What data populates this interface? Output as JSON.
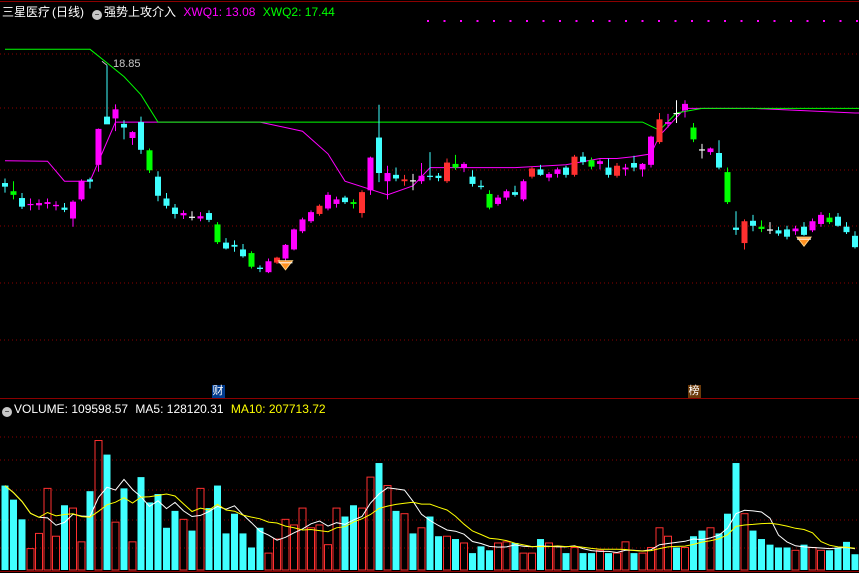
{
  "main_header": {
    "stock_title": "三星医疗",
    "period": "(日线)",
    "indicator_name": "强势上攻介入",
    "items": [
      {
        "label": "XWQ1: 13.08",
        "color": "#ff00ff"
      },
      {
        "label": "XWQ2: 17.44",
        "color": "#00ff00"
      }
    ]
  },
  "volume_header": {
    "volume_label": "VOLUME: 109598.57",
    "ma5_label": "MA5: 128120.31",
    "ma10_label": "MA10: 207713.72",
    "volume_color": "#ffffff",
    "ma5_color": "#ffffff",
    "ma10_color": "#ffff00"
  },
  "peak_label": "18.85",
  "event_marks": [
    {
      "text": "财",
      "day": 25,
      "bg": "#003a8c",
      "color": "#ffffff"
    },
    {
      "text": "榜",
      "day": 81,
      "bg": "#6b3a0a",
      "color": "#ffffff"
    }
  ],
  "colors": {
    "up": "#ff3030",
    "down": "#40ffff",
    "magenta": "#ff00ff",
    "green": "#00ff00",
    "yellow": "#ffff00",
    "white": "#ffffff",
    "grid": "#8b0000",
    "diamond": "#ff9020"
  },
  "chart_data": [
    {
      "type": "candlestick",
      "title": "强势上攻介入",
      "period": "daily",
      "y_range": [
        11.6,
        19.8
      ],
      "days": 101,
      "ohlc": [
        [
          16.26,
          16.36,
          16.05,
          16.18
        ],
        [
          16.08,
          16.3,
          15.9,
          16.0
        ],
        [
          15.93,
          16.04,
          15.69,
          15.74
        ],
        [
          15.78,
          15.92,
          15.66,
          15.8
        ],
        [
          15.77,
          15.9,
          15.67,
          15.82
        ],
        [
          15.8,
          15.92,
          15.7,
          15.84
        ],
        [
          15.75,
          15.86,
          15.66,
          15.78
        ],
        [
          15.72,
          15.82,
          15.62,
          15.67
        ],
        [
          15.48,
          15.88,
          15.3,
          15.85
        ],
        [
          15.9,
          16.34,
          15.86,
          16.31
        ],
        [
          16.34,
          16.38,
          16.14,
          16.29
        ],
        [
          16.66,
          17.46,
          16.51,
          17.45
        ],
        [
          17.72,
          18.85,
          17.64,
          17.55
        ],
        [
          17.68,
          17.99,
          17.4,
          17.88
        ],
        [
          17.56,
          17.64,
          17.22,
          17.48
        ],
        [
          17.25,
          17.4,
          17.1,
          17.38
        ],
        [
          17.6,
          17.72,
          16.9,
          16.99
        ],
        [
          16.98,
          17.02,
          16.48,
          16.54
        ],
        [
          16.4,
          16.52,
          15.86,
          15.98
        ],
        [
          15.92,
          16.04,
          15.7,
          15.76
        ],
        [
          15.72,
          15.8,
          15.48,
          15.58
        ],
        [
          15.55,
          15.66,
          15.47,
          15.6
        ],
        [
          15.52,
          15.64,
          15.44,
          15.5
        ],
        [
          15.48,
          15.62,
          15.42,
          15.53
        ],
        [
          15.6,
          15.66,
          15.4,
          15.45
        ],
        [
          15.35,
          15.4,
          14.92,
          14.96
        ],
        [
          14.95,
          15.05,
          14.8,
          14.82
        ],
        [
          14.9,
          15.0,
          14.75,
          14.86
        ],
        [
          14.8,
          14.92,
          14.62,
          14.65
        ],
        [
          14.72,
          14.76,
          14.38,
          14.42
        ],
        [
          14.4,
          14.45,
          14.3,
          14.37
        ],
        [
          14.3,
          14.6,
          14.28,
          14.54
        ],
        [
          14.51,
          14.64,
          14.48,
          14.62
        ],
        [
          14.6,
          14.92,
          14.55,
          14.9
        ],
        [
          14.8,
          15.26,
          14.78,
          15.24
        ],
        [
          15.2,
          15.5,
          15.16,
          15.46
        ],
        [
          15.42,
          15.66,
          15.38,
          15.62
        ],
        [
          15.58,
          15.79,
          15.54,
          15.76
        ],
        [
          15.7,
          16.06,
          15.66,
          16.0
        ],
        [
          15.8,
          15.96,
          15.72,
          15.9
        ],
        [
          15.94,
          15.98,
          15.8,
          15.84
        ],
        [
          15.84,
          15.9,
          15.7,
          15.8
        ],
        [
          15.6,
          16.1,
          15.5,
          16.06
        ],
        [
          16.1,
          16.84,
          16.0,
          16.82
        ],
        [
          17.26,
          17.98,
          16.28,
          16.48
        ],
        [
          16.3,
          16.64,
          15.9,
          16.48
        ],
        [
          16.44,
          16.6,
          16.3,
          16.36
        ],
        [
          16.3,
          16.44,
          16.2,
          16.34
        ],
        [
          16.32,
          16.46,
          16.1,
          16.3
        ],
        [
          16.3,
          16.7,
          16.24,
          16.42
        ],
        [
          16.42,
          16.94,
          16.32,
          16.4
        ],
        [
          16.42,
          16.48,
          16.3,
          16.37
        ],
        [
          16.3,
          16.8,
          16.26,
          16.71
        ],
        [
          16.68,
          16.88,
          16.55,
          16.6
        ],
        [
          16.6,
          16.72,
          16.5,
          16.68
        ],
        [
          16.4,
          16.54,
          16.18,
          16.24
        ],
        [
          16.2,
          16.32,
          16.12,
          16.17
        ],
        [
          16.02,
          16.1,
          15.68,
          15.72
        ],
        [
          15.8,
          16.0,
          15.76,
          15.94
        ],
        [
          15.94,
          16.12,
          15.88,
          16.08
        ],
        [
          16.06,
          16.2,
          15.96,
          16.0
        ],
        [
          15.9,
          16.34,
          15.86,
          16.3
        ],
        [
          16.4,
          16.62,
          16.36,
          16.58
        ],
        [
          16.56,
          16.66,
          16.42,
          16.44
        ],
        [
          16.38,
          16.5,
          16.3,
          16.46
        ],
        [
          16.46,
          16.6,
          16.38,
          16.56
        ],
        [
          16.6,
          16.64,
          16.38,
          16.44
        ],
        [
          16.44,
          16.88,
          16.4,
          16.84
        ],
        [
          16.84,
          16.94,
          16.66,
          16.72
        ],
        [
          16.76,
          16.82,
          16.56,
          16.62
        ],
        [
          16.68,
          16.78,
          16.56,
          16.74
        ],
        [
          16.6,
          16.8,
          16.38,
          16.44
        ],
        [
          16.42,
          16.7,
          16.38,
          16.64
        ],
        [
          16.56,
          16.68,
          16.42,
          16.6
        ],
        [
          16.7,
          16.86,
          16.52,
          16.6
        ],
        [
          16.56,
          16.7,
          16.4,
          16.68
        ],
        [
          16.66,
          17.3,
          16.6,
          17.28
        ],
        [
          17.16,
          17.8,
          17.12,
          17.66
        ],
        [
          17.56,
          17.78,
          17.48,
          17.6
        ],
        [
          17.8,
          18.08,
          17.58,
          17.78
        ],
        [
          17.86,
          18.08,
          17.7,
          18.0
        ],
        [
          17.48,
          17.58,
          17.16,
          17.22
        ],
        [
          17.0,
          17.12,
          16.8,
          16.98
        ],
        [
          16.94,
          17.04,
          16.88,
          17.02
        ],
        [
          16.92,
          17.2,
          16.56,
          16.6
        ],
        [
          16.5,
          16.6,
          15.8,
          15.84
        ],
        [
          15.28,
          15.64,
          15.12,
          15.23
        ],
        [
          14.94,
          15.46,
          14.8,
          15.42
        ],
        [
          15.43,
          15.56,
          15.2,
          15.32
        ],
        [
          15.3,
          15.44,
          15.18,
          15.25
        ],
        [
          15.24,
          15.4,
          15.14,
          15.22
        ],
        [
          15.22,
          15.3,
          15.1,
          15.15
        ],
        [
          15.24,
          15.32,
          15.02,
          15.08
        ],
        [
          15.2,
          15.32,
          15.12,
          15.26
        ],
        [
          15.3,
          15.4,
          15.1,
          15.12
        ],
        [
          15.22,
          15.48,
          15.18,
          15.42
        ],
        [
          15.36,
          15.62,
          15.3,
          15.56
        ],
        [
          15.5,
          15.6,
          15.36,
          15.4
        ],
        [
          15.52,
          15.6,
          15.3,
          15.32
        ],
        [
          15.3,
          15.4,
          15.14,
          15.18
        ],
        [
          15.1,
          15.2,
          14.82,
          14.85
        ]
      ],
      "lines": [
        {
          "name": "XWQ1",
          "color": "#ff00ff",
          "points": [
            [
              0,
              16.75
            ],
            [
              5,
              16.74
            ],
            [
              7,
              16.3
            ],
            [
              10,
              16.3
            ],
            [
              13,
              17.6
            ],
            [
              20,
              17.6
            ],
            [
              30,
              17.6
            ],
            [
              35,
              17.4
            ],
            [
              38,
              16.9
            ],
            [
              40,
              16.3
            ],
            [
              45,
              16.0
            ],
            [
              48,
              16.2
            ],
            [
              50,
              16.6
            ],
            [
              60,
              16.6
            ],
            [
              66,
              16.66
            ],
            [
              70,
              16.8
            ],
            [
              72,
              16.8
            ],
            [
              74,
              16.84
            ],
            [
              76,
              16.9
            ],
            [
              77,
              17.3
            ],
            [
              80,
              17.9
            ],
            [
              88,
              17.9
            ],
            [
              100,
              17.8
            ],
            [
              103,
              17.8
            ],
            [
              104,
              17.3
            ],
            [
              105,
              16.8
            ],
            [
              106,
              15.8
            ]
          ]
        },
        {
          "name": "XWQ2",
          "color": "#00ff00",
          "points": [
            [
              0,
              19.2
            ],
            [
              10,
              19.2
            ],
            [
              12,
              18.9
            ],
            [
              14,
              18.6
            ],
            [
              16,
              18.2
            ],
            [
              18,
              17.6
            ],
            [
              20,
              17.6
            ],
            [
              30,
              17.6
            ],
            [
              60,
              17.6
            ],
            [
              75,
              17.6
            ],
            [
              77,
              17.42
            ],
            [
              79,
              17.8
            ],
            [
              82,
              17.9
            ],
            [
              88,
              17.9
            ],
            [
              100,
              17.9
            ],
            [
              104,
              17.9
            ],
            [
              106,
              17.9
            ]
          ]
        }
      ],
      "signals": [
        {
          "type": "diamond",
          "day": 33,
          "price": 14.55
        },
        {
          "type": "diamond",
          "day": 94,
          "price": 15.07
        }
      ]
    },
    {
      "type": "bar",
      "title": "VOLUME",
      "unit": "hands",
      "y_range": [
        0,
        270000
      ],
      "values": [
        150000,
        125000,
        90000,
        38000,
        65000,
        145000,
        60000,
        115000,
        110000,
        50000,
        140000,
        230000,
        205000,
        85000,
        145000,
        50000,
        165000,
        120000,
        135000,
        75000,
        105000,
        90000,
        70000,
        145000,
        110000,
        150000,
        65000,
        100000,
        65000,
        40000,
        75000,
        30000,
        55000,
        90000,
        80000,
        110000,
        75000,
        80000,
        45000,
        110000,
        95000,
        115000,
        110000,
        165000,
        190000,
        150000,
        105000,
        100000,
        65000,
        75000,
        95000,
        60000,
        60000,
        55000,
        48000,
        30000,
        42000,
        35000,
        48000,
        50000,
        48000,
        30000,
        30000,
        55000,
        48000,
        42000,
        30000,
        40000,
        30000,
        30000,
        35000,
        30000,
        30000,
        50000,
        30000,
        30000,
        40000,
        75000,
        60000,
        40000,
        40000,
        60000,
        70000,
        75000,
        65000,
        100000,
        190000,
        100000,
        70000,
        55000,
        45000,
        40000,
        40000,
        35000,
        45000,
        40000,
        35000,
        35000,
        40000,
        50000,
        28000
      ],
      "bar_colors": "red=up day, cyan=down day",
      "lines": [
        {
          "name": "MA5",
          "color": "#ffffff"
        },
        {
          "name": "MA10",
          "color": "#ffff00"
        }
      ]
    }
  ]
}
